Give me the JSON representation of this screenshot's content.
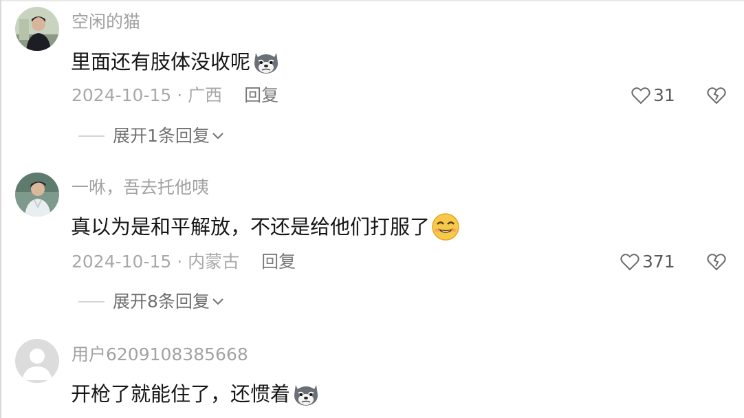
{
  "comments": [
    {
      "username": "空闲的猫",
      "text": "里面还有肢体没收呢",
      "emoji": "husky-emoji",
      "date": "2024-10-15",
      "separator": "·",
      "location": "广西",
      "reply_label": "回复",
      "likes": "31",
      "expand_label": "展开1条回复"
    },
    {
      "username": "一咻，吾去托他咦",
      "text": "真以为是和平解放，不还是给他们打服了",
      "emoji": "smirk-emoji",
      "date": "2024-10-15",
      "separator": "·",
      "location": "内蒙古",
      "reply_label": "回复",
      "likes": "371",
      "expand_label": "展开8条回复"
    },
    {
      "username": "用户6209108385668",
      "text": "开枪了就能住了，还惯着",
      "emoji": "husky-emoji"
    }
  ],
  "colors": {
    "username": "#a2a2a2",
    "text": "#161616",
    "meta": "#a8a8a8"
  }
}
